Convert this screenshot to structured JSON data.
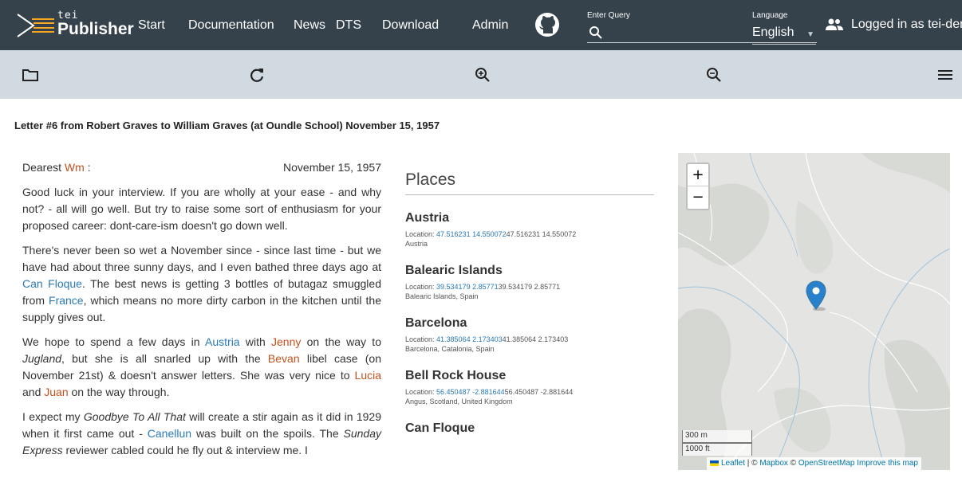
{
  "header": {
    "logo_small": "tei",
    "logo_big": "Publisher",
    "nav": [
      "Start",
      "Documentation",
      "News",
      "DTS",
      "Download",
      "Admin"
    ],
    "query_label": "Enter Query",
    "query_value": "",
    "language_label": "Language",
    "language_value": "English",
    "login_text": "Logged in as tei-demo"
  },
  "toolbar": {
    "icons": [
      "folder-icon",
      "reload-icon",
      "zoom-in-icon",
      "zoom-out-icon",
      "menu-icon"
    ]
  },
  "document": {
    "title": "Letter #6 from Robert Graves to William Graves (at Oundle School) November 15, 1957"
  },
  "letter": {
    "salutation": "Dearest",
    "salutation_name": "Wm",
    "salutation_colon": " :",
    "date": "November 15, 1957",
    "p1": "Good luck in your interview. If you are wholly at your ease - and why not? - all will go well. But try to raise some sort of enthusiasm for your proposed career: dont-care-ism doesn't go down well.",
    "p2_a": "There's never been so wet a November since - since last time - but we have had about three sunny days, and I even bathed three days ago at ",
    "p2_place1": "Can Floque",
    "p2_b": ". The best news is getting 3 bottles of butagaz smuggled from ",
    "p2_place2": "France",
    "p2_c": ", which means no more dirty carbon in the kitchen until the supply gives out.",
    "p3_a": "We hope to spend a few days in ",
    "p3_place": "Austria",
    "p3_b": " with ",
    "p3_person1": "Jenny",
    "p3_c": " on the way to ",
    "p3_italic": "Jugland",
    "p3_d": ", but she is all snarled up with the ",
    "p3_person2": "Bevan",
    "p3_e": " libel case (on November 21st) & doesn't answer letters. She was very nice to ",
    "p3_person3": "Lucia",
    "p3_f": " and ",
    "p3_person4": "Juan",
    "p3_g": " on the way through.",
    "p4_a": "I expect my ",
    "p4_italic": "Goodbye To All That",
    "p4_b": " will create a stir again as it did in 1929 when it first came out - ",
    "p4_place": "Canellun",
    "p4_c": " was built on the spoils. The ",
    "p4_italic2": "Sunday Express",
    "p4_d": " reviewer cabled could he fly out & interview me. I"
  },
  "places": {
    "heading": "Places",
    "location_label": "Location: ",
    "items": [
      {
        "name": "Austria",
        "coord_link": "47.516231 14.550072",
        "coord_text": "47.516231 14.550072",
        "desc": "Austria"
      },
      {
        "name": "Balearic Islands",
        "coord_link": "39.534179 2.85771",
        "coord_text": "39.534179 2.85771",
        "desc": "Balearic Islands, Spain"
      },
      {
        "name": "Barcelona",
        "coord_link": "41.385064 2.173403",
        "coord_text": "41.385064 2.173403",
        "desc": "Barcelona, Catalonia, Spain"
      },
      {
        "name": "Bell Rock House",
        "coord_link": "56.450487 -2.881644",
        "coord_text": "56.450487 -2.881644",
        "desc": "Angus, Scotland, United Kingdom"
      },
      {
        "name": "Can Floque",
        "coord_link": "",
        "coord_text": "",
        "desc": ""
      }
    ]
  },
  "map": {
    "zoom_in": "+",
    "zoom_out": "−",
    "scale_metric": "300 m",
    "scale_imperial": "1000 ft",
    "attribution_leaflet": "Leaflet",
    "attribution_sep1": " | © ",
    "attribution_mapbox": "Mapbox",
    "attribution_sep2": " © ",
    "attribution_osm": "OpenStreetMap",
    "attribution_sep3": " ",
    "attribution_improve": "Improve this map"
  },
  "colors": {
    "topbar": "#35424b",
    "toolbar": "#d1dae0",
    "place_link": "#2a7ab8",
    "person_link": "#c4501d",
    "marker": "#2a81cb"
  }
}
